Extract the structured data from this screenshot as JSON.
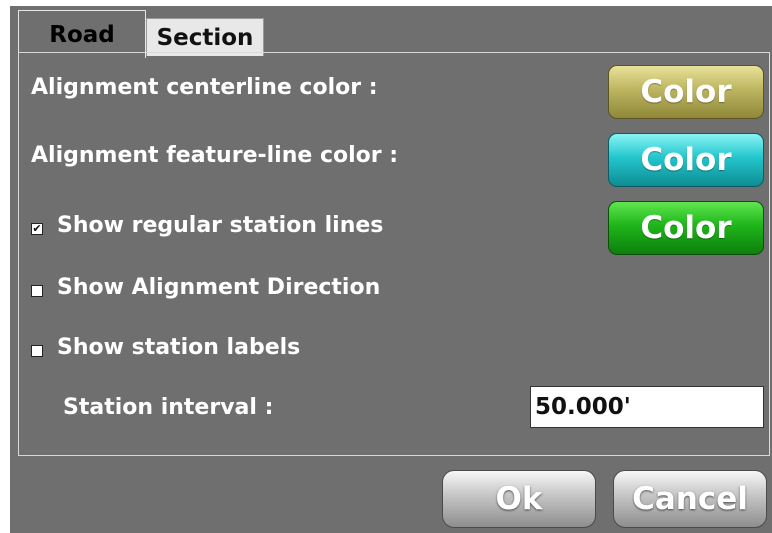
{
  "tabs": [
    {
      "label": "Road",
      "active": true
    },
    {
      "label": "Section",
      "active": false
    }
  ],
  "rows": {
    "centerline_label": "Alignment centerline color :",
    "featureline_label": "Alignment feature-line color :",
    "regular_lines_label": "Show regular station lines",
    "direction_label": "Show Alignment Direction",
    "station_labels_label": "Show station labels",
    "interval_label": "Station interval :"
  },
  "checks": {
    "regular_lines": "✔",
    "direction": "",
    "station_labels": ""
  },
  "color_buttons": {
    "centerline": "Color",
    "featureline": "Color",
    "regular_lines": "Color"
  },
  "colors": {
    "centerline": "#bdb560",
    "featureline": "#22c6cc",
    "regular_lines": "#1fb51a",
    "background": "#6f6f6f"
  },
  "station_interval_value": "50.000'",
  "buttons": {
    "ok": "Ok",
    "cancel": "Cancel"
  }
}
